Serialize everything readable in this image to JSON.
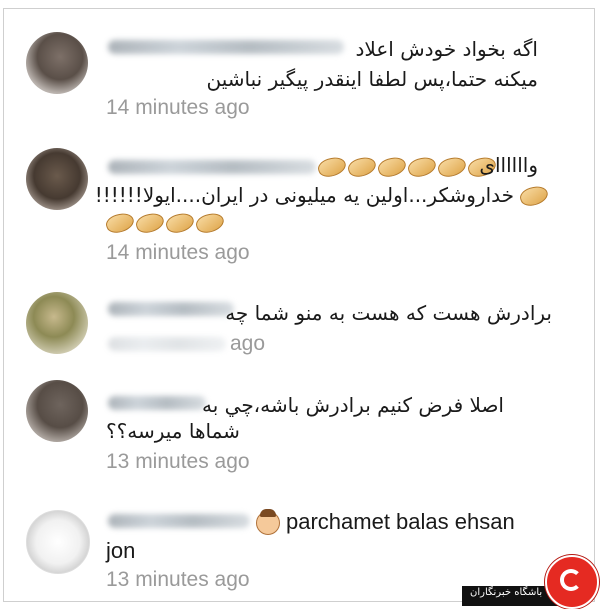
{
  "comments": [
    {
      "id": "c1",
      "lines": [
        "اگه بخواد خودش اعلاد",
        "میکنه حتما،پس لطفا اینقدر پیگیر نباشین"
      ],
      "time": "14 minutes ago",
      "avatar_icon": "user-avatar-photo"
    },
    {
      "id": "c2",
      "lines": [
        "واااااای",
        "خداروشکر...اولین یه میلیونی در ایران....ایولا!!!!!!"
      ],
      "time": "14 minutes ago",
      "emoji": "clapping-hands-icon",
      "avatar_icon": "user-avatar-photo"
    },
    {
      "id": "c3",
      "lines": [
        "برادرش هست که هست به منو  شما چه"
      ],
      "time": "ago",
      "avatar_icon": "user-avatar-photo"
    },
    {
      "id": "c4",
      "lines": [
        "اصلا فرض کنیم برادرش باشه،چي به",
        "شماها میرسه؟؟"
      ],
      "time": "13 minutes ago",
      "avatar_icon": "user-avatar-photo"
    },
    {
      "id": "c5",
      "lines": [
        "parchamet balas ehsan",
        "jon"
      ],
      "time": "13 minutes ago",
      "emoji": "face-with-hand-icon",
      "avatar_icon": "user-avatar-photo"
    }
  ],
  "watermark": {
    "text": "باشگاه خبرنگاران",
    "brand_color": "#e52a22"
  },
  "colors": {
    "text": "#1a1a1a",
    "timestamp": "#9a9a9a",
    "background": "#ffffff"
  }
}
